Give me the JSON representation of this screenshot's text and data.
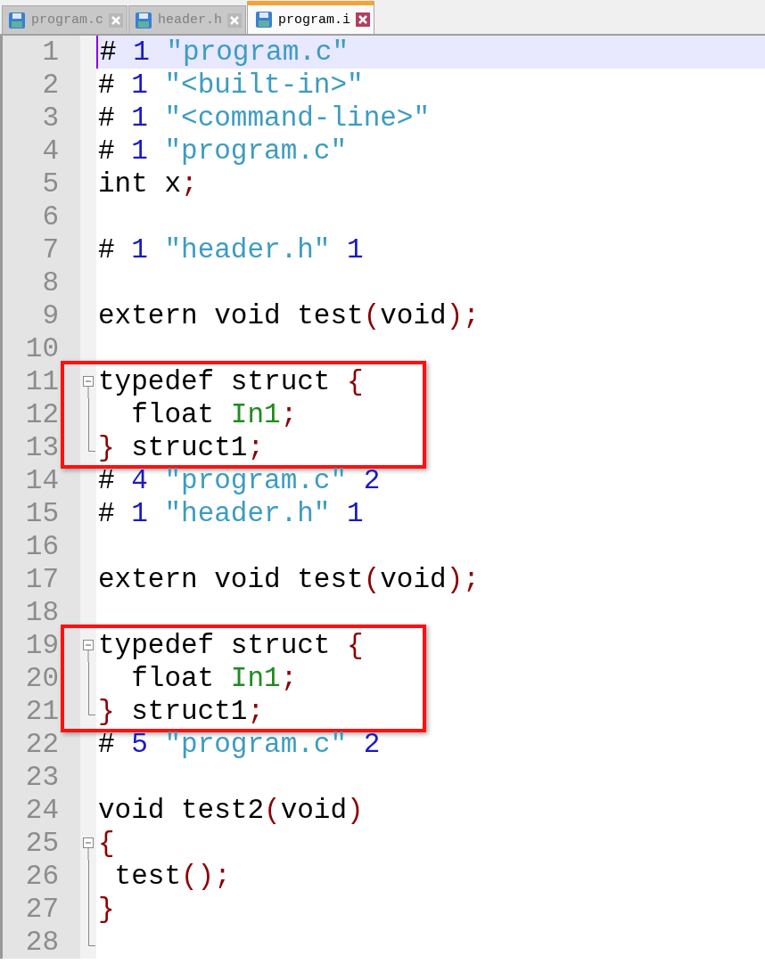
{
  "tabs": [
    {
      "label": "program.c",
      "selected": false
    },
    {
      "label": "header.h",
      "selected": false
    },
    {
      "label": "program.i",
      "selected": true
    }
  ],
  "blocks": [
    {
      "boxed": false,
      "lines": [
        {
          "number": "1",
          "kind": "plain",
          "current": true,
          "tokens": [
            {
              "kind": "plain",
              "text": "# "
            },
            {
              "kind": "num",
              "text": "1"
            },
            {
              "kind": "str",
              "text": " \"program.c\""
            }
          ]
        },
        {
          "number": "2",
          "kind": "plain",
          "current": false,
          "tokens": [
            {
              "kind": "plain",
              "text": "# "
            },
            {
              "kind": "num",
              "text": "1"
            },
            {
              "kind": "str",
              "text": " \"<built-in>\""
            }
          ]
        },
        {
          "number": "3",
          "kind": "plain",
          "current": false,
          "tokens": [
            {
              "kind": "plain",
              "text": "# "
            },
            {
              "kind": "num",
              "text": "1"
            },
            {
              "kind": "str",
              "text": " \"<command-line>\""
            }
          ]
        },
        {
          "number": "4",
          "kind": "plain",
          "current": false,
          "tokens": [
            {
              "kind": "plain",
              "text": "# "
            },
            {
              "kind": "num",
              "text": "1"
            },
            {
              "kind": "str",
              "text": " \"program.c\""
            }
          ]
        },
        {
          "number": "5",
          "kind": "plain",
          "current": false,
          "tokens": [
            {
              "kind": "plain",
              "text": "int x"
            },
            {
              "kind": "op",
              "text": ";"
            }
          ]
        },
        {
          "number": "6",
          "kind": "plain",
          "current": false
        },
        {
          "number": "7",
          "kind": "plain",
          "current": false,
          "tokens": [
            {
              "kind": "plain",
              "text": "# "
            },
            {
              "kind": "num",
              "text": "1"
            },
            {
              "kind": "str",
              "text": " \"header.h\""
            },
            {
              "kind": "num",
              "text": " 1"
            }
          ]
        },
        {
          "number": "8",
          "kind": "plain",
          "current": false
        },
        {
          "number": "9",
          "kind": "plain",
          "current": false,
          "tokens": [
            {
              "kind": "plain",
              "text": "extern void test"
            },
            {
              "kind": "op",
              "text": "("
            },
            {
              "kind": "plain",
              "text": "void"
            },
            {
              "kind": "op",
              "text": ");"
            }
          ]
        },
        {
          "number": "10",
          "kind": "plain",
          "current": false
        }
      ]
    },
    {
      "boxed": true,
      "lines": [
        {
          "number": "11",
          "kind": "fold_start",
          "current": false,
          "tokens": [
            {
              "kind": "plain",
              "text": "typedef struct "
            },
            {
              "kind": "op",
              "text": "{"
            }
          ]
        },
        {
          "number": "12",
          "kind": "fold_body",
          "current": false,
          "tokens": [
            {
              "kind": "plain",
              "text": "  float "
            },
            {
              "kind": "ident",
              "text": "In1"
            },
            {
              "kind": "op",
              "text": ";"
            }
          ]
        },
        {
          "number": "13",
          "kind": "fold_end",
          "current": false,
          "tokens": [
            {
              "kind": "op",
              "text": "}"
            },
            {
              "kind": "plain",
              "text": " struct1"
            },
            {
              "kind": "op",
              "text": ";"
            }
          ]
        }
      ]
    },
    {
      "boxed": false,
      "lines": [
        {
          "number": "14",
          "kind": "plain",
          "current": false,
          "tokens": [
            {
              "kind": "plain",
              "text": "# "
            },
            {
              "kind": "num",
              "text": "4"
            },
            {
              "kind": "str",
              "text": " \"program.c\""
            },
            {
              "kind": "num",
              "text": " 2"
            }
          ]
        },
        {
          "number": "15",
          "kind": "plain",
          "current": false,
          "tokens": [
            {
              "kind": "plain",
              "text": "# "
            },
            {
              "kind": "num",
              "text": "1"
            },
            {
              "kind": "str",
              "text": " \"header.h\""
            },
            {
              "kind": "num",
              "text": " 1"
            }
          ]
        },
        {
          "number": "16",
          "kind": "plain",
          "current": false
        },
        {
          "number": "17",
          "kind": "plain",
          "current": false,
          "tokens": [
            {
              "kind": "plain",
              "text": "extern void test"
            },
            {
              "kind": "op",
              "text": "("
            },
            {
              "kind": "plain",
              "text": "void"
            },
            {
              "kind": "op",
              "text": ");"
            }
          ]
        },
        {
          "number": "18",
          "kind": "plain",
          "current": false
        }
      ]
    },
    {
      "boxed": true,
      "lines": [
        {
          "number": "19",
          "kind": "fold_start",
          "current": false,
          "tokens": [
            {
              "kind": "plain",
              "text": "typedef struct "
            },
            {
              "kind": "op",
              "text": "{"
            }
          ]
        },
        {
          "number": "20",
          "kind": "fold_body",
          "current": false,
          "tokens": [
            {
              "kind": "plain",
              "text": "  float "
            },
            {
              "kind": "ident",
              "text": "In1"
            },
            {
              "kind": "op",
              "text": ";"
            }
          ]
        },
        {
          "number": "21",
          "kind": "fold_end",
          "current": false,
          "tokens": [
            {
              "kind": "op",
              "text": "}"
            },
            {
              "kind": "plain",
              "text": " struct1"
            },
            {
              "kind": "op",
              "text": ";"
            }
          ]
        }
      ]
    },
    {
      "boxed": false,
      "lines": [
        {
          "number": "22",
          "kind": "plain",
          "current": false,
          "tokens": [
            {
              "kind": "plain",
              "text": "# "
            },
            {
              "kind": "num",
              "text": "5"
            },
            {
              "kind": "str",
              "text": " \"program.c\""
            },
            {
              "kind": "num",
              "text": " 2"
            }
          ]
        },
        {
          "number": "23",
          "kind": "plain",
          "current": false
        },
        {
          "number": "24",
          "kind": "plain",
          "current": false,
          "tokens": [
            {
              "kind": "plain",
              "text": "void test2"
            },
            {
              "kind": "op",
              "text": "("
            },
            {
              "kind": "plain",
              "text": "void"
            },
            {
              "kind": "op",
              "text": ")"
            }
          ]
        },
        {
          "number": "25",
          "kind": "fold_start",
          "current": false,
          "tokens": [
            {
              "kind": "op",
              "text": "{"
            }
          ]
        },
        {
          "number": "26",
          "kind": "fold_body",
          "current": false,
          "tokens": [
            {
              "kind": "plain",
              "text": " test"
            },
            {
              "kind": "op",
              "text": "();"
            }
          ]
        },
        {
          "number": "27",
          "kind": "fold_body",
          "current": false,
          "tokens": [
            {
              "kind": "op",
              "text": "}"
            }
          ]
        },
        {
          "number": "28",
          "kind": "fold_end",
          "current": false
        }
      ]
    }
  ]
}
